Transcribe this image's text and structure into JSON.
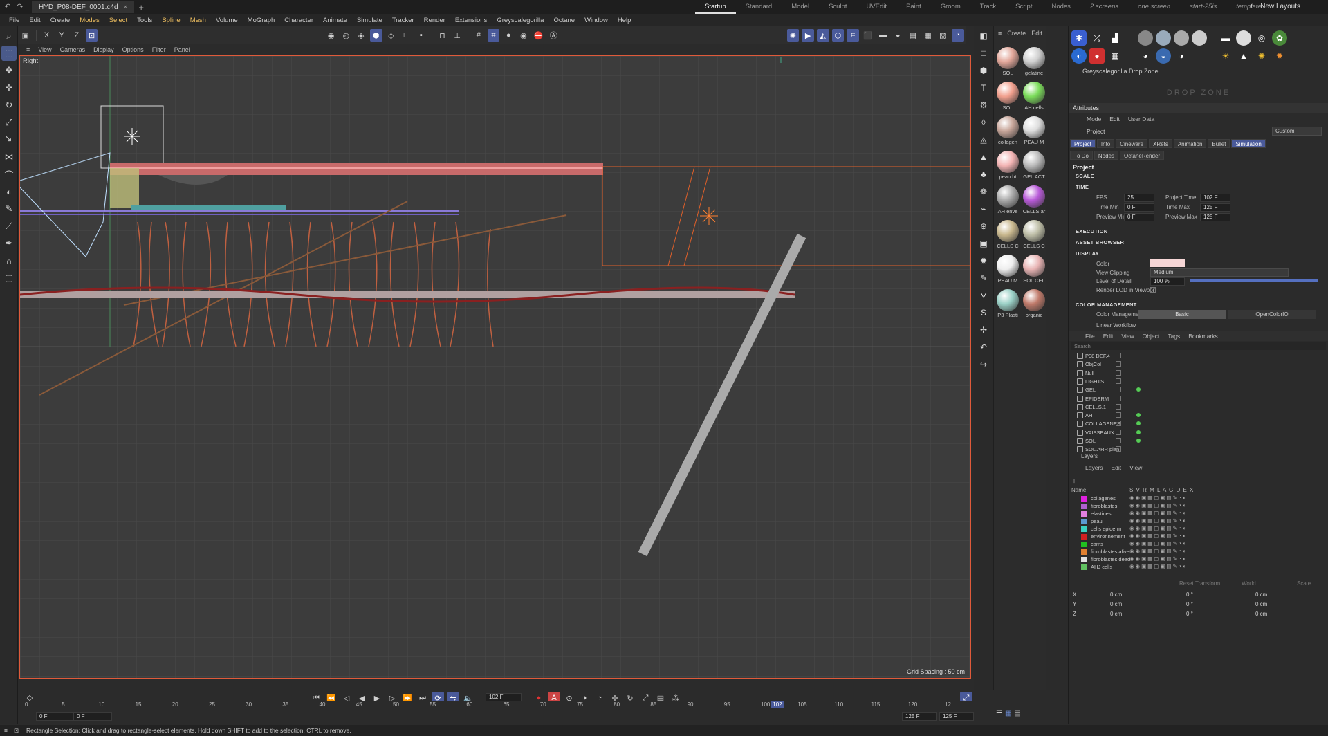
{
  "title_bar": {
    "doc_tab": "HYD_P08-DEF_0001.c4d",
    "layouts": [
      "Startup",
      "Standard",
      "Model",
      "Sculpt",
      "UVEdit",
      "Paint",
      "Groom",
      "Track",
      "Script",
      "Nodes",
      "2 screens",
      "one screen",
      "start-25is",
      "template"
    ],
    "active_layout": "Startup",
    "new_layouts": "New Layouts"
  },
  "menu": [
    "File",
    "Edit",
    "Create",
    "Modes",
    "Select",
    "Tools",
    "Spline",
    "Mesh",
    "Volume",
    "MoGraph",
    "Character",
    "Animate",
    "Simulate",
    "Tracker",
    "Render",
    "Extensions",
    "Greyscalegorilla",
    "Octane",
    "Window",
    "Help"
  ],
  "toolbar": {
    "x": "X",
    "y": "Y",
    "z": "Z"
  },
  "viewport": {
    "menu": [
      "View",
      "Cameras",
      "Display",
      "Options",
      "Filter",
      "Panel"
    ],
    "label": "Right",
    "grid_spacing": "Grid Spacing : 50 cm"
  },
  "materials": {
    "header_create": "Create",
    "header_edit": "Edit",
    "items": [
      {
        "label": "SOL",
        "color": "#e2a79a"
      },
      {
        "label": "gelatine",
        "color": "#cfcfcf"
      },
      {
        "label": "SOL",
        "color": "#f2a08e"
      },
      {
        "label": "AH cells",
        "color": "#7bdc5a"
      },
      {
        "label": "collagen",
        "color": "#c8a69a"
      },
      {
        "label": "PEAU M",
        "color": "#dddddd"
      },
      {
        "label": "peau ht",
        "color": "#f3b4b4"
      },
      {
        "label": "GEL ACT",
        "color": "#bbbbbb"
      },
      {
        "label": "AH enve",
        "color": "#aaaaaa"
      },
      {
        "label": "CELLS ar",
        "color": "#b85ad8"
      },
      {
        "label": "CELLS C",
        "color": "#c9b88e"
      },
      {
        "label": "CELLS C",
        "color": "#bfbfa8"
      },
      {
        "label": "PEAU M",
        "color": "#eeeeee"
      },
      {
        "label": "SOL CEL",
        "color": "#e8b4b4"
      },
      {
        "label": "P3 Plasti",
        "color": "#9ad0c6"
      },
      {
        "label": "organic",
        "color": "#c07a6a"
      }
    ]
  },
  "attributes": {
    "dropzone_header": "Greyscalegorilla Drop Zone",
    "dropzone": "DROP ZONE",
    "title": "Attributes",
    "menu": [
      "Mode",
      "Edit",
      "User Data"
    ],
    "object": "Project",
    "preset": "Custom",
    "tabs_row1": [
      "Project",
      "Info",
      "Cineware",
      "XRefs",
      "Animation",
      "Bullet",
      "Simulation"
    ],
    "tabs_row2": [
      "To Do",
      "Nodes",
      "OctaneRender"
    ],
    "section_title": "Project",
    "sections": {
      "scale": "SCALE",
      "time": "TIME",
      "execution": "EXECUTION",
      "asset_browser": "ASSET BROWSER",
      "display": "DISPLAY",
      "color_management": "COLOR MANAGEMENT"
    },
    "time": {
      "fps_label": "FPS",
      "fps": "25",
      "project_time_label": "Project Time",
      "project_time": "102 F",
      "time_min_label": "Time Min",
      "time_min": "0 F",
      "time_max_label": "Time Max",
      "time_max": "125 F",
      "preview_min_label": "Preview Min",
      "preview_min": "0 F",
      "preview_max_label": "Preview Max",
      "preview_max": "125 F"
    },
    "display": {
      "color_label": "Color",
      "color": "#f6d6d6",
      "clipping_label": "View Clipping",
      "clipping": "Medium",
      "lod_label": "Level of Detail",
      "lod": "100 %",
      "lod_fraction": 1.0,
      "render_lod_label": "Render LOD in Viewport"
    },
    "color_mgmt": {
      "label": "Color Management",
      "basic": "Basic",
      "ocio": "OpenColorIO",
      "linear": "Linear Workflow"
    }
  },
  "objects": {
    "menu": [
      "File",
      "Edit",
      "View",
      "Object",
      "Tags",
      "Bookmarks"
    ],
    "search_placeholder": "Search",
    "items": [
      {
        "name": "P08 DEF.4",
        "dot": false
      },
      {
        "name": "ObjCol",
        "dot": false
      },
      {
        "name": "Null",
        "dot": false
      },
      {
        "name": "LIGHTS",
        "dot": false
      },
      {
        "name": "GEL",
        "dot": true
      },
      {
        "name": "EPIDERM",
        "dot": false
      },
      {
        "name": "CELLS.1",
        "dot": false
      },
      {
        "name": "AH",
        "dot": true
      },
      {
        "name": "COLLAGENES",
        "dot": true
      },
      {
        "name": "VAISSEAUX",
        "dot": true
      },
      {
        "name": "SOL",
        "dot": true
      },
      {
        "name": "SOL.ARR plan",
        "dot": false
      }
    ]
  },
  "layers": {
    "title": "Layers",
    "menu": [
      "Layers",
      "Edit",
      "View"
    ],
    "col_name": "Name",
    "col_flags": "S V R M L A G D E X",
    "items": [
      {
        "name": "collagenes",
        "color": "#e020e0"
      },
      {
        "name": "fibroblastes",
        "color": "#b060d0"
      },
      {
        "name": "elastines",
        "color": "#e080e0"
      },
      {
        "name": "peau",
        "color": "#5a9ad0"
      },
      {
        "name": "cells epiderm",
        "color": "#3ad0c0"
      },
      {
        "name": "environnement",
        "color": "#d02020"
      },
      {
        "name": "cams",
        "color": "#20c020"
      },
      {
        "name": "fibroblastes alive",
        "color": "#e08030"
      },
      {
        "name": "fibroblastes dead",
        "color": "#e0e0e0"
      },
      {
        "name": "AHJ cells",
        "color": "#60c060"
      }
    ]
  },
  "coords": {
    "reset": "Reset Transform",
    "world": "World",
    "scale": "Scale",
    "rows": [
      {
        "axis": "X",
        "pos": "0 cm",
        "rot": "0 °",
        "size": "0 cm"
      },
      {
        "axis": "Y",
        "pos": "0 cm",
        "rot": "0 °",
        "size": "0 cm"
      },
      {
        "axis": "Z",
        "pos": "0 cm",
        "rot": "0 °",
        "size": "0 cm"
      }
    ]
  },
  "timeline": {
    "current_frame": "102 F",
    "ticks": [
      "0",
      "5",
      "10",
      "15",
      "20",
      "25",
      "30",
      "35",
      "40",
      "45",
      "50",
      "55",
      "60",
      "65",
      "70",
      "75",
      "80",
      "85",
      "90",
      "95",
      "100",
      "105",
      "110",
      "115",
      "120",
      "12"
    ],
    "playhead_label": "102",
    "start_a": "0 F",
    "start_b": "0 F",
    "end_a": "125 F",
    "end_b": "125 F"
  },
  "status": "Rectangle Selection: Click and drag to rectangle-select elements. Hold down SHIFT to add to the selection, CTRL to remove."
}
